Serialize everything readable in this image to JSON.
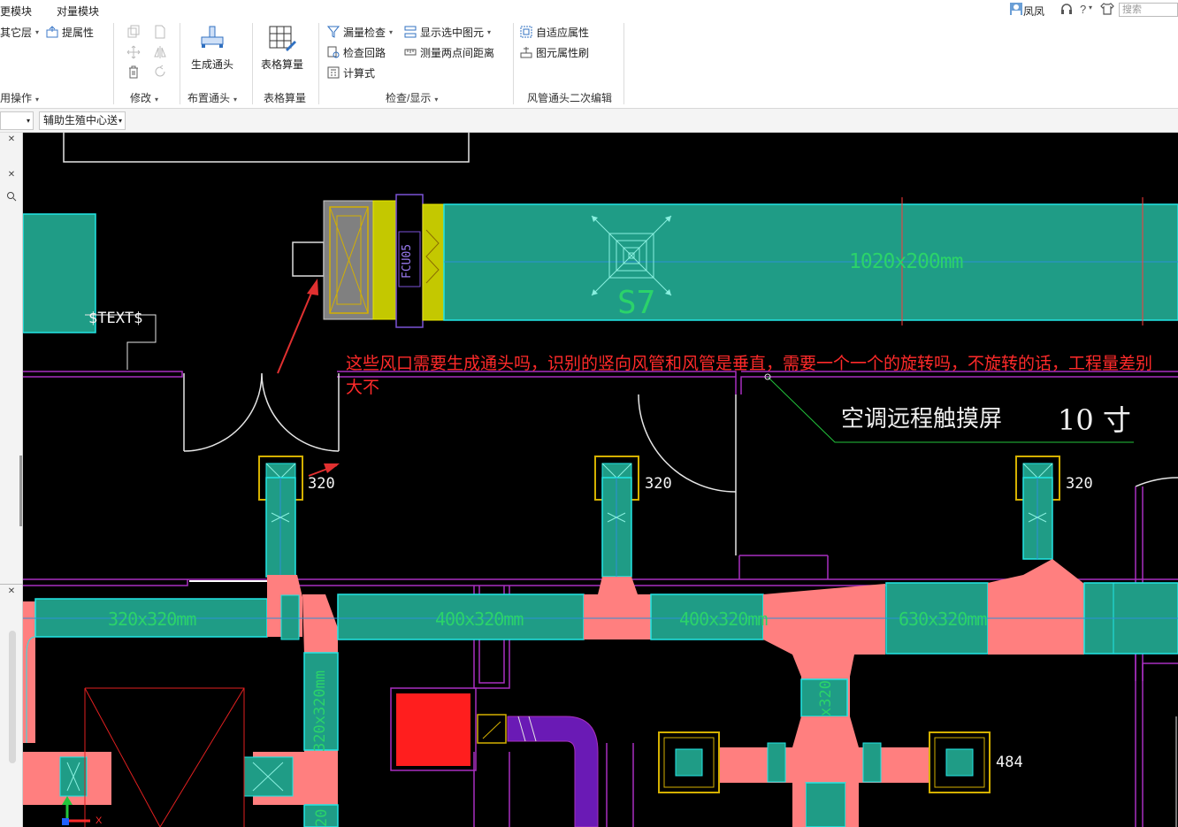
{
  "menubar": {
    "items": [
      "更模块",
      "对量模块"
    ],
    "username": "凤凤",
    "help_label": "?",
    "search_placeholder": "搜索"
  },
  "ribbon": {
    "group_common": {
      "buttons": [
        "其它层",
        "提属性"
      ],
      "title": "用操作"
    },
    "group_modify": {
      "title": "修改"
    },
    "group_layout": {
      "button": "生成通头",
      "title": "布置通头"
    },
    "group_table": {
      "button": "表格算量",
      "title": "表格算量"
    },
    "group_check": {
      "buttons": [
        "漏量检查",
        "显示选中图元",
        "检查回路",
        "测量两点间距离",
        "计算式"
      ],
      "title": "检查/显示"
    },
    "group_edit": {
      "buttons": [
        "自适应属性",
        "图元属性刷"
      ],
      "title": "风管通头二次编辑"
    }
  },
  "selector_bar": {
    "first_value": "",
    "second_value": "辅助生殖中心送"
  },
  "canvas": {
    "labels": {
      "text_placeholder": "$TEXT$",
      "fcu": "FCU05",
      "duct_top": "1020x200mm",
      "s7": "S7",
      "touchscreen": "空调远程触摸屏",
      "size_10": "10 寸",
      "vent1": "320",
      "vent2": "320",
      "vent3": "320",
      "duct_a": "320x320mm",
      "duct_b": "400x320mm",
      "duct_c": "400x320mm",
      "duct_d": "630x320mm",
      "duct_v1": "320x320mm",
      "duct_v2": "x320",
      "duct_v3": "20",
      "vent4": "484",
      "axis_x": "X"
    },
    "annotation": "这些风口需要生成通头吗，识别的竖向风管和风管是垂直，需要一个一个的旋转吗，不旋转的话，工程量差别大不"
  },
  "colors": {
    "duct_fill": "#1f9c86",
    "duct_edge": "#22e6e6",
    "fitting_pink": "#ff7f7f",
    "wall_magenta": "#a82fbf",
    "annotation_red": "#ff2a2a",
    "dim_green": "#2bd36a",
    "vent_yellow": "#d4b000"
  }
}
